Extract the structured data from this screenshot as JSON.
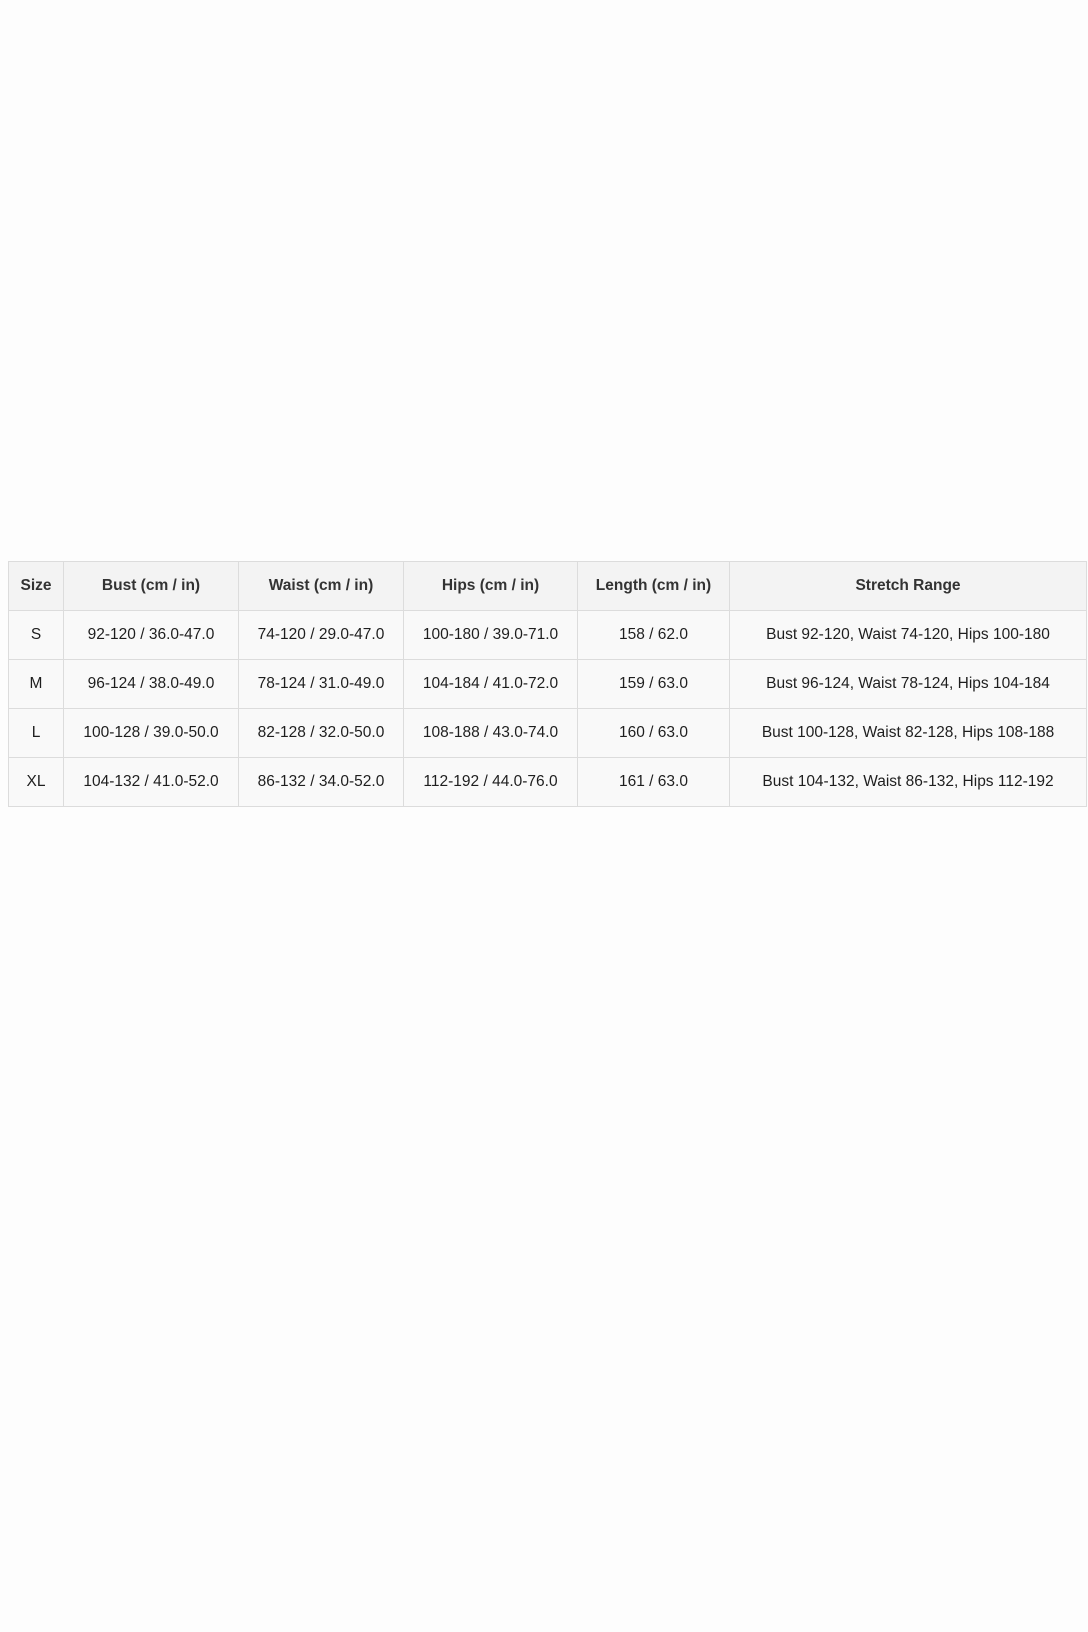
{
  "size_chart": {
    "headers": [
      "Size",
      "Bust (cm / in)",
      "Waist (cm / in)",
      "Hips (cm / in)",
      "Length (cm / in)",
      "Stretch Range"
    ],
    "rows": [
      [
        "S",
        "92-120 / 36.0-47.0",
        "74-120 / 29.0-47.0",
        "100-180 / 39.0-71.0",
        "158 / 62.0",
        "Bust 92-120, Waist 74-120, Hips 100-180"
      ],
      [
        "M",
        "96-124 / 38.0-49.0",
        "78-124 / 31.0-49.0",
        "104-184 / 41.0-72.0",
        "159 / 63.0",
        "Bust 96-124, Waist 78-124, Hips 104-184"
      ],
      [
        "L",
        "100-128 / 39.0-50.0",
        "82-128 / 32.0-50.0",
        "108-188 / 43.0-74.0",
        "160 / 63.0",
        "Bust 100-128, Waist 82-128, Hips 108-188"
      ],
      [
        "XL",
        "104-132 / 41.0-52.0",
        "86-132 / 34.0-52.0",
        "112-192 / 44.0-76.0",
        "161 / 63.0",
        "Bust 104-132, Waist 86-132, Hips 112-192"
      ]
    ]
  },
  "colors": {
    "background": "#fdfdfd",
    "header_bg": "#f3f3f3",
    "row_bg": "#f9f9f9",
    "border": "#dcdcdc",
    "text": "#1e1e1e"
  }
}
